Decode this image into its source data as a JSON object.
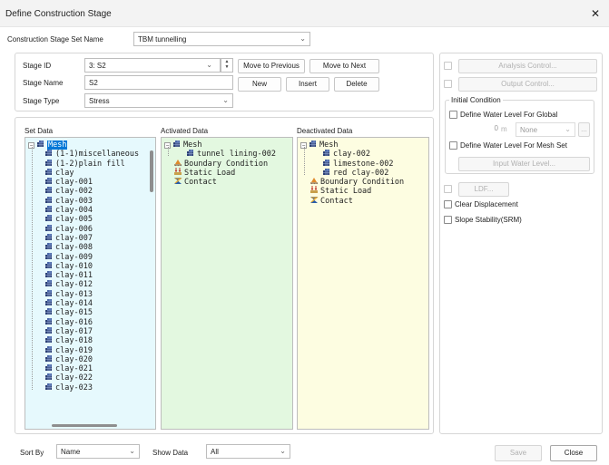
{
  "window": {
    "title": "Define Construction Stage",
    "close": "✕"
  },
  "stage_set": {
    "label": "Construction Stage Set Name",
    "value": "TBM tunnelling"
  },
  "stage": {
    "id_label": "Stage ID",
    "id_value": "3: S2",
    "name_label": "Stage Name",
    "name_value": "S2",
    "type_label": "Stage Type",
    "type_value": "Stress"
  },
  "buttons": {
    "move_prev": "Move to Previous",
    "move_next": "Move to Next",
    "new": "New",
    "insert": "Insert",
    "delete": "Delete",
    "save": "Save",
    "close": "Close"
  },
  "right": {
    "analysis_control": "Analysis Control...",
    "output_control": "Output Control...",
    "initial_condition": "Initial Condition",
    "water_global": "Define Water Level For Global",
    "water_value": "0",
    "water_unit": "m",
    "water_select": "None",
    "water_more": "...",
    "water_mesh": "Define Water Level For Mesh Set",
    "input_water": "Input Water Level...",
    "ldf": "LDF...",
    "clear_disp": "Clear Displacement",
    "slope": "Slope Stability(SRM)"
  },
  "panels": {
    "set_data": "Set Data",
    "activated": "Activated Data",
    "deactivated": "Deactivated Data"
  },
  "set_data": {
    "root": "Mesh",
    "items": [
      "(1-1)miscellaneous",
      "(1-2)plain fill",
      "clay",
      "clay-001",
      "clay-002",
      "clay-003",
      "clay-004",
      "clay-005",
      "clay-006",
      "clay-007",
      "clay-008",
      "clay-009",
      "clay-010",
      "clay-011",
      "clay-012",
      "clay-013",
      "clay-014",
      "clay-015",
      "clay-016",
      "clay-017",
      "clay-018",
      "clay-019",
      "clay-020",
      "clay-021",
      "clay-022",
      "clay-023"
    ]
  },
  "activated": {
    "root": "Mesh",
    "mesh_items": [
      "tunnel lining-002"
    ],
    "others": [
      "Boundary Condition",
      "Static Load",
      "Contact"
    ]
  },
  "deactivated": {
    "root": "Mesh",
    "mesh_items": [
      "clay-002",
      "limestone-002",
      "red clay-002"
    ],
    "others": [
      "Boundary Condition",
      "Static Load",
      "Contact"
    ]
  },
  "bottom": {
    "sort_label": "Sort By",
    "sort_value": "Name",
    "show_label": "Show Data",
    "show_value": "All"
  },
  "colors": {
    "set_bg": "#e6f9fd",
    "act_bg": "#e3f8e0",
    "deact_bg": "#fdfde1",
    "selection": "#0078d7"
  },
  "icons": {
    "mesh": "mesh-icon",
    "boundary": "boundary-condition-icon",
    "load": "static-load-icon",
    "contact": "contact-icon"
  }
}
